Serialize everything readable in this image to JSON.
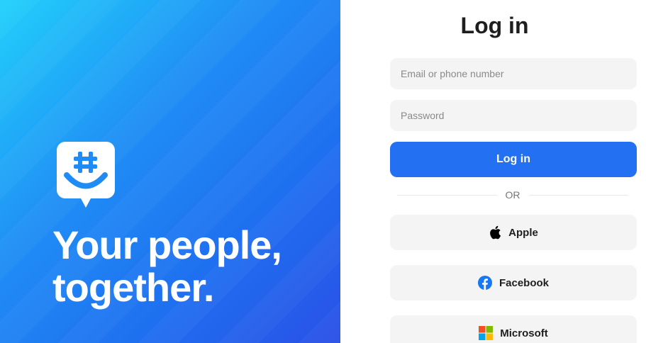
{
  "hero": {
    "tagline": "Your people,\ntogether.",
    "logo_icon": "groupme-logo-icon",
    "colors": {
      "gradient_start": "#22d0fb",
      "gradient_end": "#2a50e6"
    }
  },
  "login": {
    "title": "Log in",
    "email_placeholder": "Email or phone number",
    "password_placeholder": "Password",
    "submit_label": "Log in",
    "divider_text": "OR",
    "accent_color": "#2470f2",
    "providers": [
      {
        "label": "Apple",
        "icon": "apple-icon"
      },
      {
        "label": "Facebook",
        "icon": "facebook-icon"
      },
      {
        "label": "Microsoft",
        "icon": "microsoft-icon"
      }
    ]
  }
}
